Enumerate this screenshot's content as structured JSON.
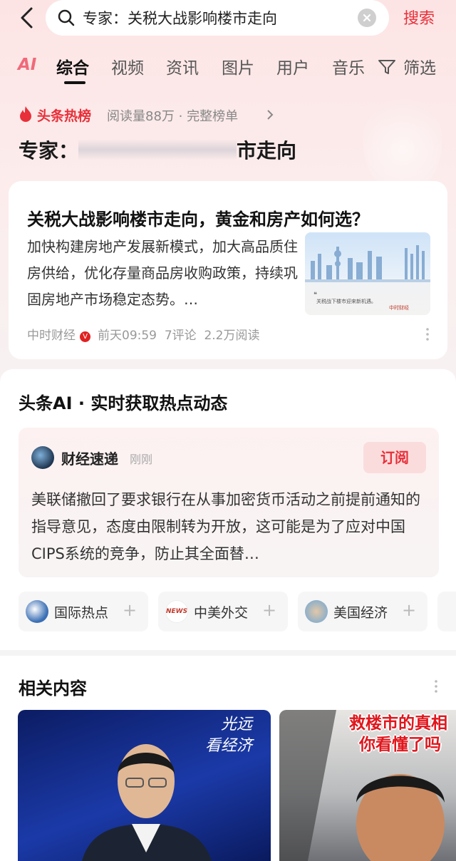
{
  "search": {
    "query": "专家：关税大战影响楼市走向",
    "button_label": "搜索"
  },
  "tabs": {
    "ai_logo": "AI",
    "items": [
      "综合",
      "视频",
      "资讯",
      "图片",
      "用户",
      "音乐"
    ],
    "active_index": 0,
    "filter_label": "筛选"
  },
  "hot": {
    "label": "头条热榜",
    "meta": "阅读量88万 · 完整榜单",
    "title_prefix": "专家：",
    "title_suffix": "市走向"
  },
  "article": {
    "title": "关税大战影响楼市走向，黄金和房产如何选？",
    "summary": "加快构建房地产发展新模式，加大高品质住房供给，优化存量商品房收购政策，持续巩固房地产市场稳定态势。…",
    "thumb_caption": "关税战下楼市迎来新机遇。",
    "thumb_brand": "中时财经",
    "source": "中时财经",
    "time": "前天09:59",
    "comments": "7评论",
    "reads": "2.2万阅读"
  },
  "ai_section": {
    "title": "头条AI · 实时获取热点动态",
    "source": "财经速递",
    "time": "刚刚",
    "subscribe_label": "订阅",
    "text": "美联储撤回了要求银行在从事加密货币活动之前提前通知的指导意见，态度由限制转为开放，这可能是为了应对中国CIPS系统的竞争，防止其全面替…",
    "chips": [
      {
        "label": "国际热点",
        "icon": "world-news-icon"
      },
      {
        "label": "中美外交",
        "icon": "news-icon"
      },
      {
        "label": "美国经济",
        "icon": "map-icon"
      }
    ]
  },
  "related": {
    "title": "相关内容",
    "videos": [
      {
        "caption_line1": "光远",
        "caption_line2": "看经济"
      },
      {
        "caption_line1": "救楼市的真相",
        "caption_line2": "你看懂了吗"
      }
    ]
  },
  "colors": {
    "accent": "#e8303a",
    "tab_active": "#111111"
  }
}
